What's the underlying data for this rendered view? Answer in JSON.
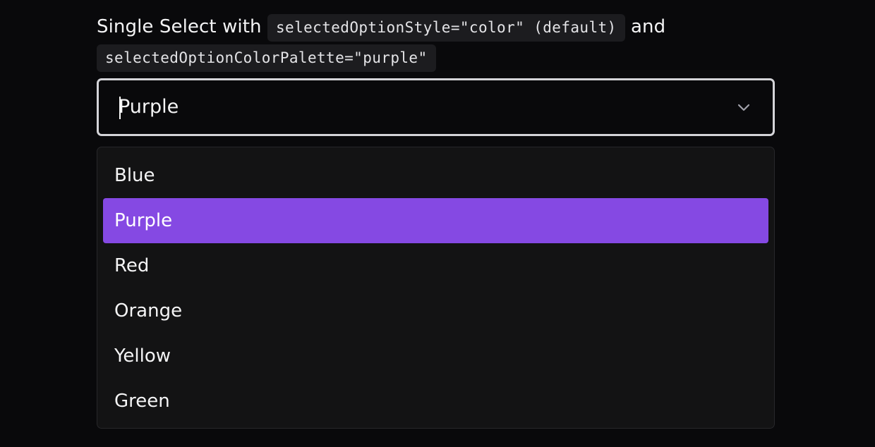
{
  "heading": {
    "prefix": "Single Select with ",
    "code1": "selectedOptionStyle=\"color\" (default)",
    "middle": " and",
    "code2": "selectedOptionColorPalette=\"purple\""
  },
  "select": {
    "value": "Purple"
  },
  "options": [
    {
      "label": "Blue"
    },
    {
      "label": "Purple"
    },
    {
      "label": "Red"
    },
    {
      "label": "Orange"
    },
    {
      "label": "Yellow"
    },
    {
      "label": "Green"
    }
  ],
  "selected_index": 1,
  "colors": {
    "selected_option_bg": "#8549e3",
    "background": "#09090b",
    "menu_bg": "#131314",
    "border": "#d4d4d8"
  },
  "icons": {
    "dropdown_indicator": "chevron-down-icon"
  }
}
